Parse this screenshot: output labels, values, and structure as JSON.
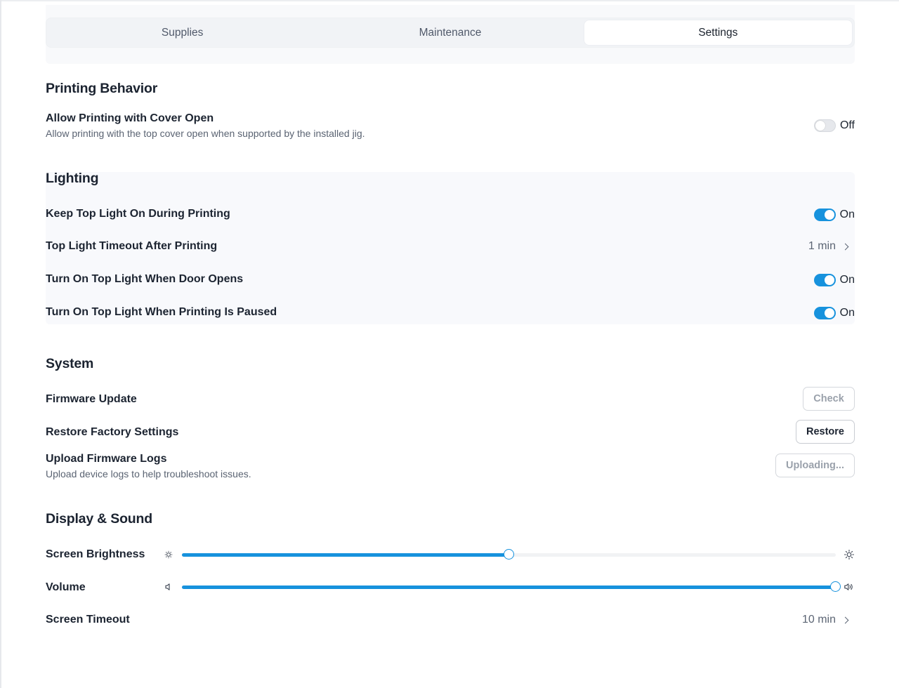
{
  "tabs": [
    {
      "label": "Supplies",
      "active": false
    },
    {
      "label": "Maintenance",
      "active": false
    },
    {
      "label": "Settings",
      "active": true
    }
  ],
  "printing_behavior": {
    "title": "Printing Behavior",
    "cover_open": {
      "label": "Allow Printing with Cover Open",
      "description": "Allow printing with the top cover open when supported by the installed jig.",
      "state": "Off"
    }
  },
  "lighting": {
    "title": "Lighting",
    "keep_top_light": {
      "label": "Keep Top Light On During Printing",
      "state": "On"
    },
    "timeout": {
      "label": "Top Light Timeout After Printing",
      "value": "1 min"
    },
    "door_opens": {
      "label": "Turn On Top Light When Door Opens",
      "state": "On"
    },
    "paused": {
      "label": "Turn On Top Light When Printing Is Paused",
      "state": "On"
    }
  },
  "system": {
    "title": "System",
    "firmware_update": {
      "label": "Firmware Update",
      "button": "Check"
    },
    "restore": {
      "label": "Restore Factory Settings",
      "button": "Restore"
    },
    "upload_logs": {
      "label": "Upload Firmware Logs",
      "description": "Upload device logs to help troubleshoot issues.",
      "button": "Uploading..."
    }
  },
  "display_sound": {
    "title": "Display & Sound",
    "brightness": {
      "label": "Screen Brightness",
      "percent": 50
    },
    "volume": {
      "label": "Volume",
      "percent": 100
    },
    "screen_timeout": {
      "label": "Screen Timeout",
      "value": "10 min"
    }
  },
  "colors": {
    "accent": "#1792dd"
  }
}
